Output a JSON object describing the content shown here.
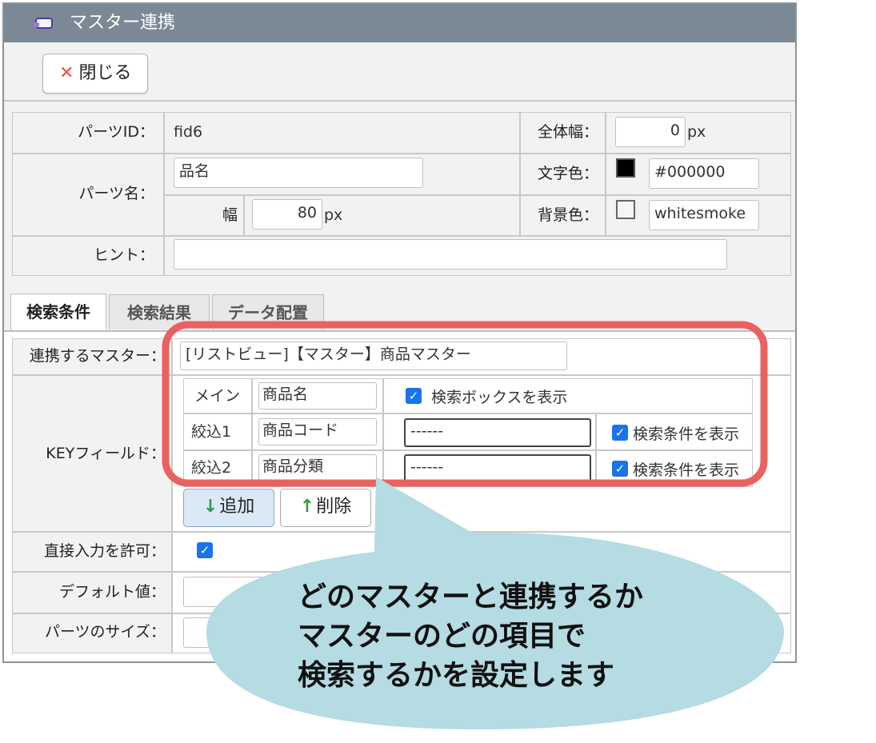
{
  "window": {
    "title": "マスター連携",
    "close_label": "閉じる"
  },
  "colors": {
    "titlebar": "#7a8995",
    "highlight": "#e9625f",
    "callout": "#b5dbe3",
    "check": "#1a73e8"
  },
  "props": {
    "part_id_label": "パーツID：",
    "part_id_value": "fid6",
    "total_width_label": "全体幅：",
    "total_width_value": "0",
    "px": "px",
    "part_name_label": "パーツ名：",
    "part_name_value": "品名",
    "width_label": "幅",
    "width_value": "80",
    "text_color_label": "文字色：",
    "text_color_value": "#000000",
    "bg_color_label": "背景色：",
    "bg_color_value": "whitesmoke",
    "hint_label": "ヒント：",
    "hint_value": ""
  },
  "tabs": [
    {
      "label": "検索条件",
      "active": true
    },
    {
      "label": "検索結果",
      "active": false
    },
    {
      "label": "データ配置",
      "active": false
    }
  ],
  "search": {
    "master_label": "連携するマスター：",
    "master_value": "[リストビュー]【マスター】商品マスター",
    "key_label": "KEYフィールド：",
    "rows": [
      {
        "name": "メイン",
        "field": "商品名",
        "select": "",
        "check_label": "検索ボックスを表示",
        "checked": true
      },
      {
        "name": "絞込1",
        "field": "商品コード",
        "select": "------",
        "check_label": "検索条件を表示",
        "checked": true
      },
      {
        "name": "絞込2",
        "field": "商品分類",
        "select": "------",
        "check_label": "検索条件を表示",
        "checked": true
      }
    ],
    "add_label": "追加",
    "remove_label": "削除",
    "allow_direct_label": "直接入力を許可：",
    "default_label": "デフォルト値：",
    "size_label": "パーツのサイズ："
  },
  "callout": {
    "lines": [
      "どのマスターと連携するか",
      "マスターのどの項目で",
      "検索するかを設定します"
    ]
  }
}
